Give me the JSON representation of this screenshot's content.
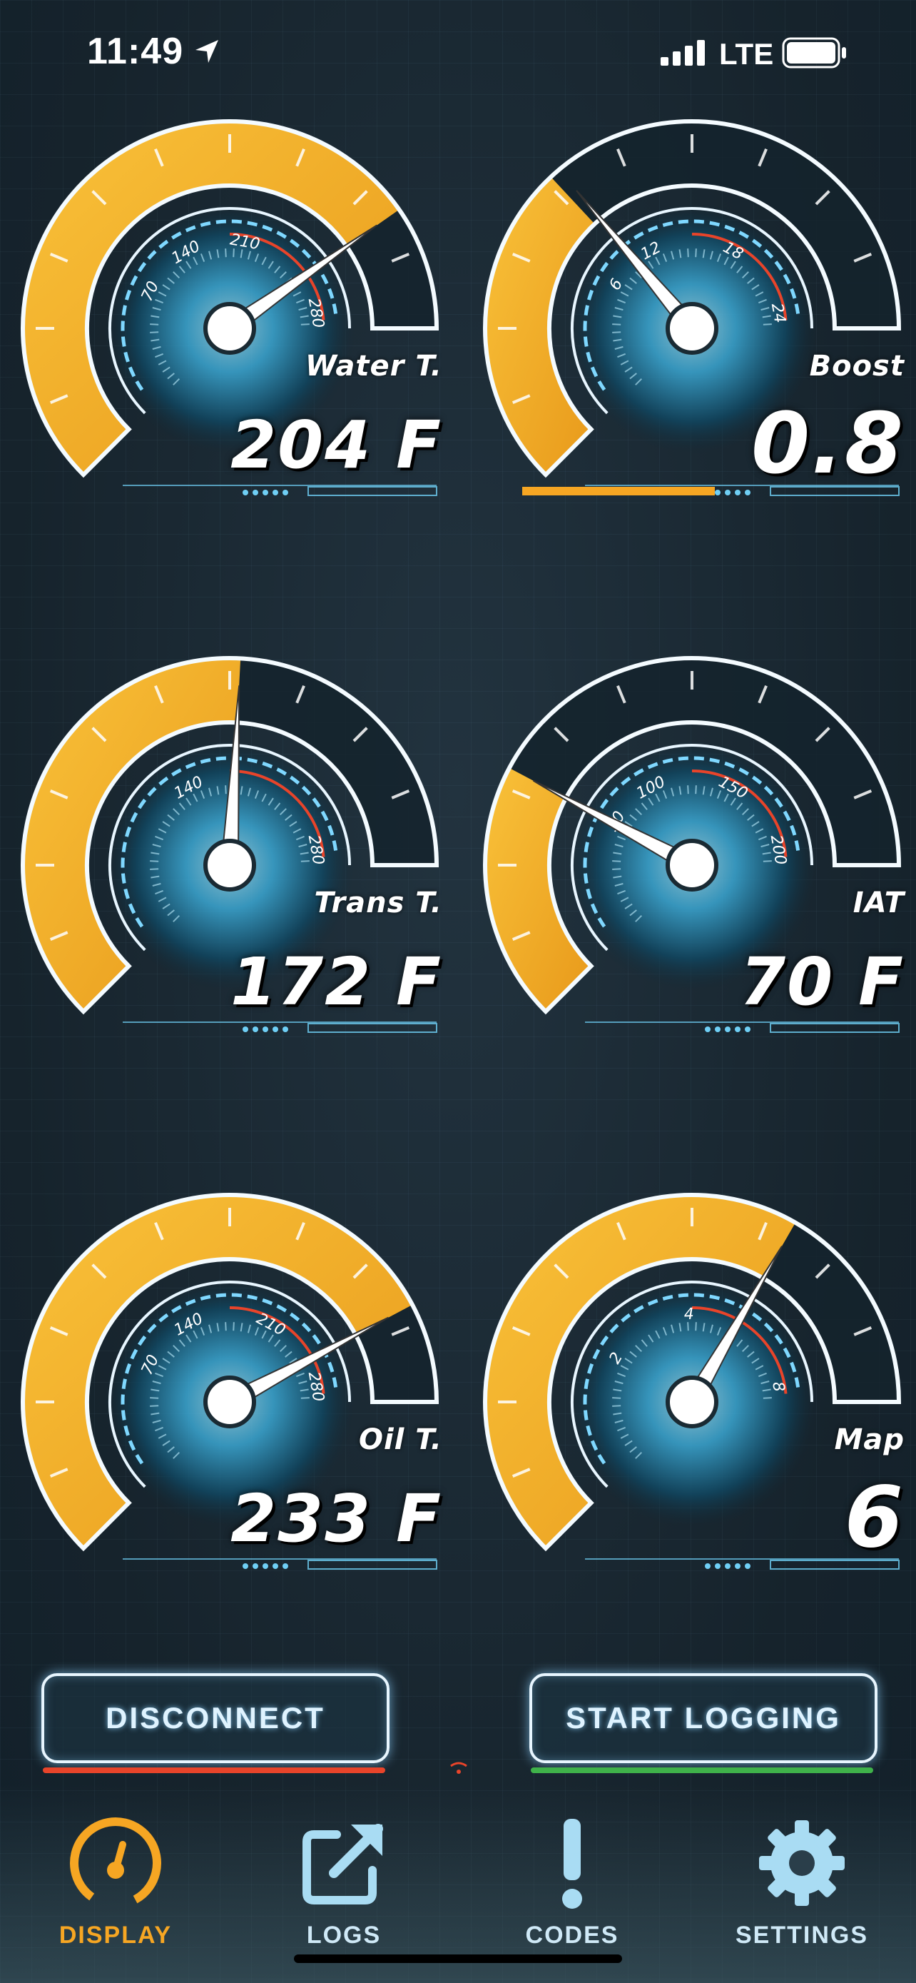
{
  "status_bar": {
    "time": "11:49",
    "network": "LTE"
  },
  "colors": {
    "accent": "#f6a623",
    "disconnect": "#e8442a",
    "logging": "#3fb24a",
    "glow": "#4fd2ff"
  },
  "gauges": [
    {
      "label": "Water T.",
      "value": "204 F",
      "ticks": [
        "70",
        "140",
        "210",
        "280"
      ]
    },
    {
      "label": "Boost",
      "value": "0.8",
      "ticks": [
        "6",
        "12",
        "18",
        "24"
      ]
    },
    {
      "label": "Trans T.",
      "value": "172 F",
      "ticks": [
        "140",
        "280"
      ]
    },
    {
      "label": "IAT",
      "value": "70 F",
      "ticks": [
        "50",
        "100",
        "150",
        "200"
      ]
    },
    {
      "label": "Oil T.",
      "value": "233 F",
      "ticks": [
        "70",
        "140",
        "210",
        "280"
      ]
    },
    {
      "label": "Map",
      "value": "6",
      "ticks": [
        "2",
        "4",
        "8"
      ]
    }
  ],
  "buttons": {
    "disconnect": "DISCONNECT",
    "start_logging": "START LOGGING"
  },
  "nav": [
    {
      "label": "DISPLAY",
      "icon": "gauge-icon",
      "active": true
    },
    {
      "label": "LOGS",
      "icon": "export-icon",
      "active": false
    },
    {
      "label": "CODES",
      "icon": "exclamation-icon",
      "active": false
    },
    {
      "label": "SETTINGS",
      "icon": "gear-icon",
      "active": false
    }
  ]
}
